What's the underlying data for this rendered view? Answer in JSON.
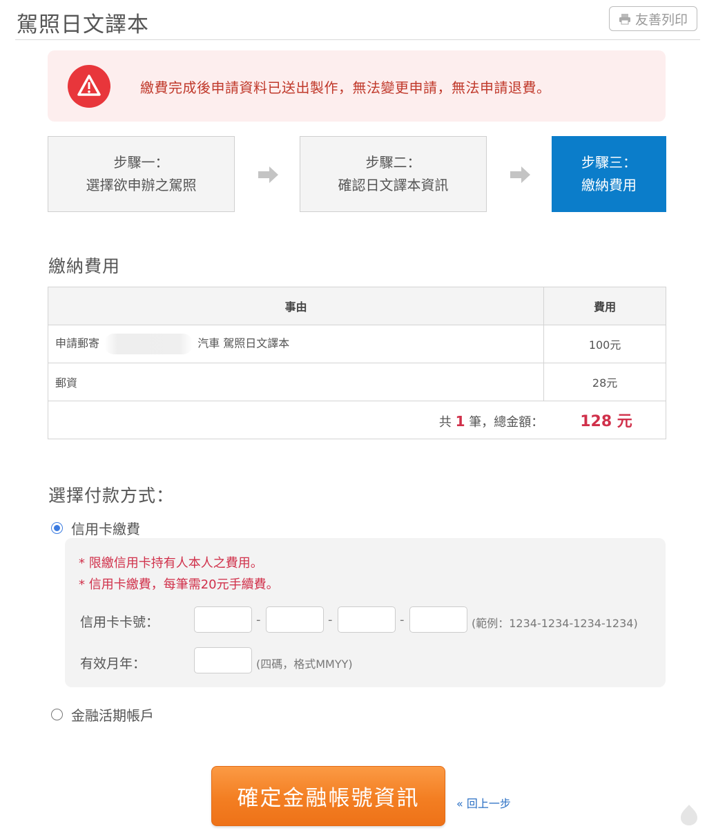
{
  "header": {
    "title": "駕照日文譯本",
    "print_label": "友善列印"
  },
  "alert": {
    "message": "繳費完成後申請資料已送出製作，無法變更申請，無法申請退費。"
  },
  "steps": [
    {
      "line1": "步驟一：",
      "line2": "選擇欲申辦之駕照",
      "active": false
    },
    {
      "line1": "步驟二：",
      "line2": "確認日文譯本資訊",
      "active": false
    },
    {
      "line1": "步驟三：",
      "line2": "繳納費用",
      "active": true
    }
  ],
  "fees": {
    "section_title": "繳納費用",
    "columns": [
      "事由",
      "費用"
    ],
    "rows": [
      {
        "item_prefix": "申請郵寄",
        "item_suffix": "汽車 駕照日文譯本",
        "fee": "100元"
      },
      {
        "item_prefix": "郵資",
        "item_suffix": "",
        "fee": "28元"
      }
    ],
    "total": {
      "prefix": "共",
      "count": "1",
      "middle": "筆，總金額：",
      "amount": "128 元"
    }
  },
  "payment": {
    "section_title": "選擇付款方式：",
    "options": [
      {
        "label": "信用卡繳費",
        "selected": true
      },
      {
        "label": "金融活期帳戶",
        "selected": false
      }
    ],
    "notes": [
      "* 限繳信用卡持有人本人之費用。",
      "* 信用卡繳費，每筆需20元手續費。"
    ],
    "card_number_label": "信用卡卡號：",
    "card_number_hint": "(範例：1234-1234-1234-1234)",
    "expiry_label": "有效月年：",
    "expiry_hint": "(四碼，格式MMYY)",
    "dash": "-"
  },
  "actions": {
    "submit_label": "確定金融帳號資訊",
    "back_label": "« 回上一步"
  },
  "colors": {
    "accent_blue": "#0b7dca",
    "alert_red": "#e8363b",
    "emphasis_red": "#d0304a",
    "button_orange": "#f37e22"
  }
}
